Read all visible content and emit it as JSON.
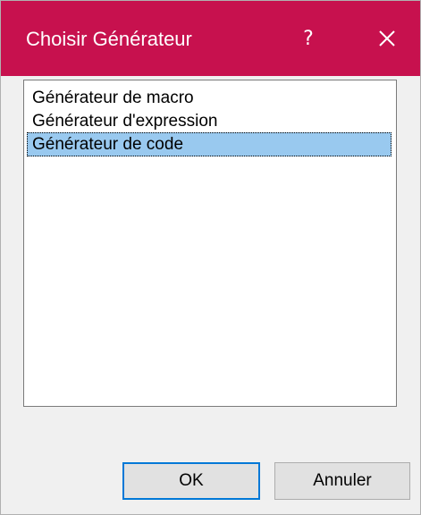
{
  "dialog": {
    "title": "Choisir Générateur",
    "help_label": "?",
    "accent_color": "#c7114e"
  },
  "list": {
    "items": [
      {
        "label": "Générateur de macro",
        "selected": false
      },
      {
        "label": "Générateur d'expression",
        "selected": false
      },
      {
        "label": "Générateur de code",
        "selected": true
      }
    ],
    "selection_color": "#99c9ef"
  },
  "buttons": {
    "ok_label": "OK",
    "cancel_label": "Annuler"
  },
  "icons": {
    "help": "help-icon",
    "close": "close-icon"
  }
}
